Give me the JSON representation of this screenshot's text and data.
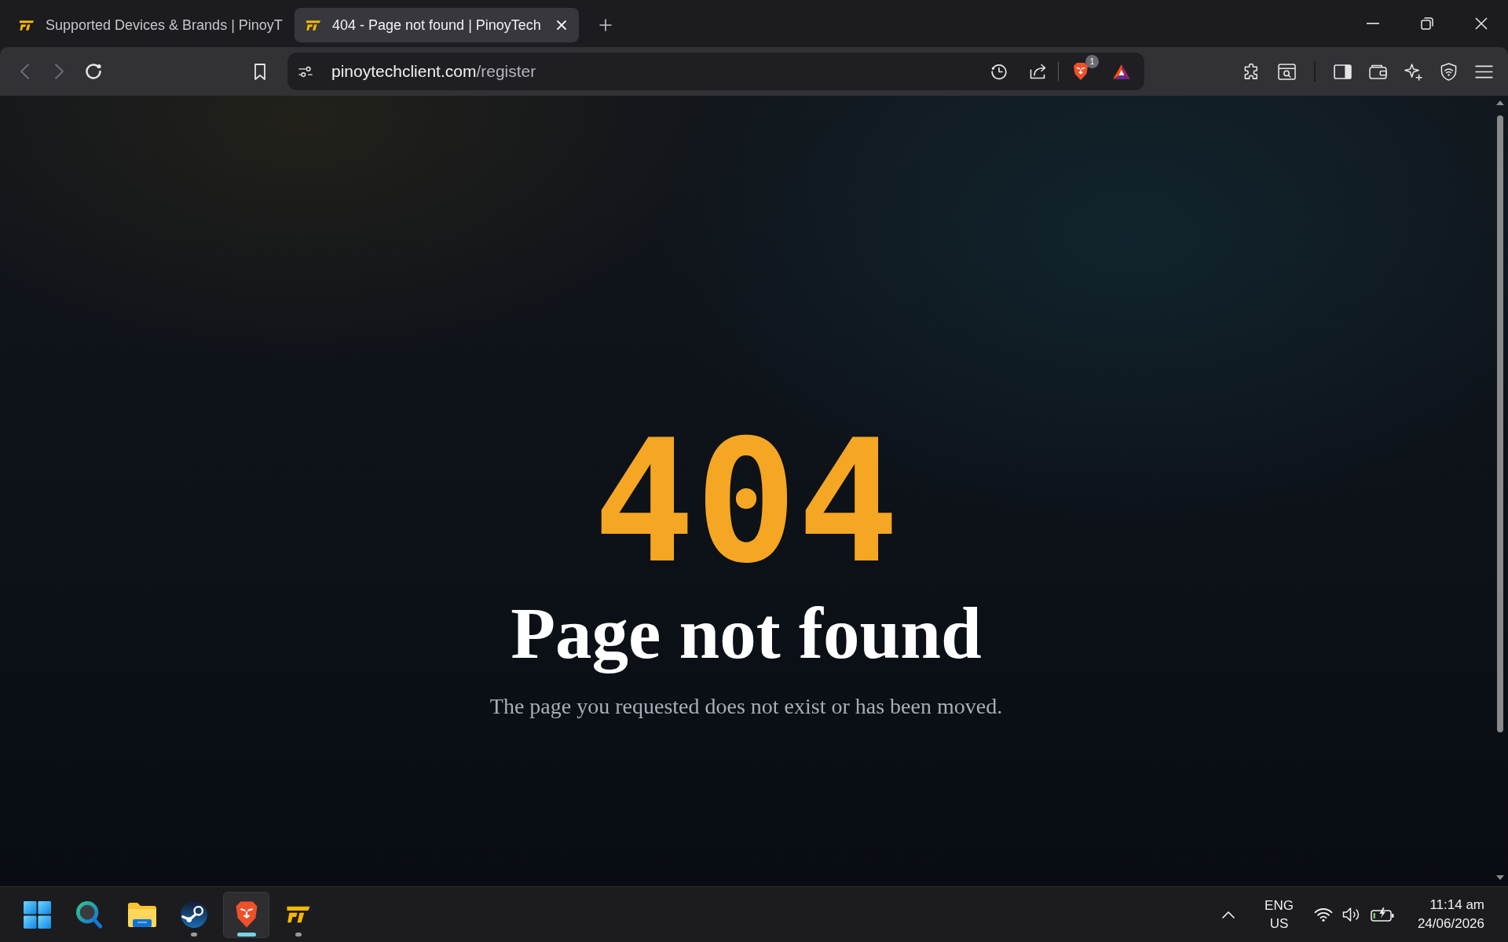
{
  "browser": {
    "tabs": [
      {
        "title": "Supported Devices & Brands | PinoyT",
        "selected": false
      },
      {
        "title": "404 - Page not found | PinoyTech",
        "selected": true
      }
    ],
    "nav": [
      {
        "kind": "back",
        "disabled": true
      },
      {
        "kind": "forward",
        "disabled": true
      },
      {
        "kind": "reload",
        "disabled": false
      }
    ],
    "address": {
      "host": "pinoytechclient.com",
      "path": "/register"
    },
    "shields_count": "1"
  },
  "page": {
    "code": "404",
    "title": "Page not found",
    "message": "The page you requested does not exist or has been moved."
  },
  "taskbar": {
    "apps": [
      {
        "kind": "start",
        "selected": false,
        "running": false
      },
      {
        "kind": "search",
        "selected": false,
        "running": false
      },
      {
        "kind": "files",
        "selected": false,
        "running": false
      },
      {
        "kind": "steam",
        "selected": false,
        "running": true
      },
      {
        "kind": "brave",
        "selected": true,
        "running": true
      },
      {
        "kind": "pinoytech",
        "selected": false,
        "running": true
      }
    ],
    "language": {
      "code": "ENG",
      "region": "US"
    },
    "time": "11:14 am",
    "date": "24/06/2026"
  }
}
